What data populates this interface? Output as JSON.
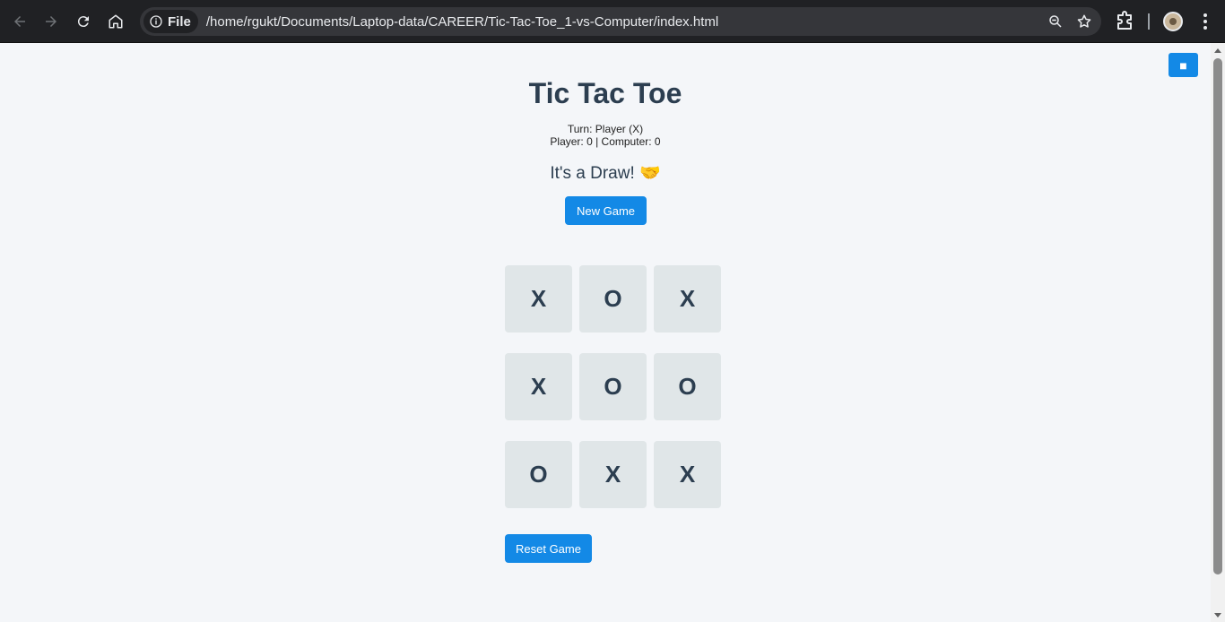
{
  "browser": {
    "address_chip": "File",
    "url": "/home/rgukt/Documents/Laptop-data/CAREER/Tic-Tac-Toe_1-vs-Computer/index.html"
  },
  "game": {
    "corner_button": "■",
    "title": "Tic Tac Toe",
    "turn": "Turn: Player (X)",
    "score": "Player: 0 | Computer: 0",
    "status": "It's a Draw! 🤝",
    "new_game_label": "New Game",
    "reset_game_label": "Reset Game",
    "board": [
      "X",
      "O",
      "X",
      "X",
      "O",
      "O",
      "O",
      "X",
      "X"
    ]
  },
  "colors": {
    "accent": "#1389e6",
    "cell_bg": "#e0e6e8",
    "text_dark": "#2c3e50",
    "page_bg": "#f4f6f9"
  }
}
